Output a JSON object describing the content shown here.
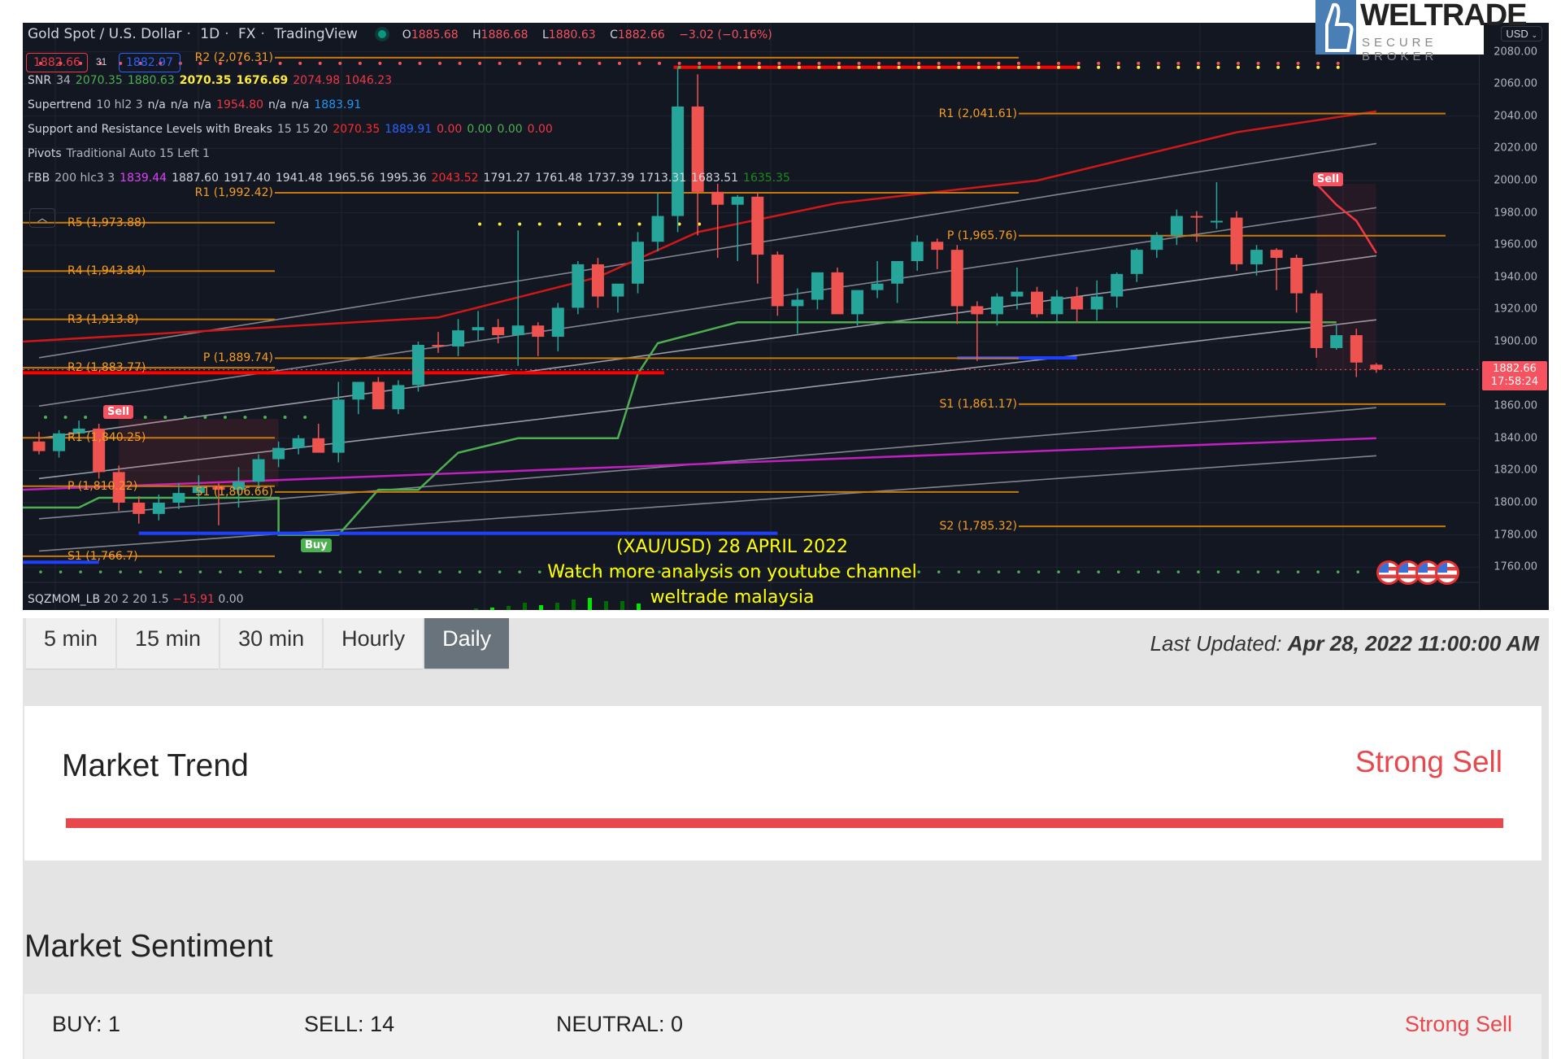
{
  "chart_header": {
    "symbol": "Gold Spot / U.S. Dollar",
    "interval": "1D",
    "exchange": "FX",
    "source": "TradingView",
    "open_label": "O",
    "open": "1885.68",
    "high_label": "H",
    "high": "1886.68",
    "low_label": "L",
    "low": "1880.63",
    "close_label": "C",
    "close": "1882.66",
    "change": "−3.02 (−0.16%)",
    "bid": "1882.66",
    "spread": "31",
    "ask": "1882.97"
  },
  "indicators": [
    {
      "name": "SNR",
      "params": "34",
      "values": [
        {
          "v": "2070.35",
          "c": "g"
        },
        {
          "v": "1880.63",
          "c": "g"
        },
        {
          "v": "2070.35",
          "c": "y"
        },
        {
          "v": "1676.69",
          "c": "y"
        },
        {
          "v": "2074.98",
          "c": "r"
        },
        {
          "v": "1046.23",
          "c": "r"
        }
      ]
    },
    {
      "name": "Supertrend",
      "params": "10 hl2 3",
      "values": [
        {
          "v": "n/a",
          "c": "w"
        },
        {
          "v": "n/a",
          "c": "w"
        },
        {
          "v": "n/a",
          "c": "w"
        },
        {
          "v": "1954.80",
          "c": "r"
        },
        {
          "v": "n/a",
          "c": "w"
        },
        {
          "v": "n/a",
          "c": "w"
        },
        {
          "v": "1883.91",
          "c": "sb"
        }
      ]
    },
    {
      "name": "Support and Resistance Levels with Breaks",
      "params": "15 15 20",
      "values": [
        {
          "v": "2070.35",
          "c": "rb"
        },
        {
          "v": "1889.91",
          "c": "b"
        },
        {
          "v": "0.00",
          "c": "r"
        },
        {
          "v": "0.00",
          "c": "g"
        },
        {
          "v": "0.00",
          "c": "g"
        },
        {
          "v": "0.00",
          "c": "r"
        }
      ]
    },
    {
      "name": "Pivots",
      "params": "Traditional Auto 15 Left 1",
      "values": []
    },
    {
      "name": "FBB",
      "params": "200 hlc3 3",
      "values": [
        {
          "v": "1839.44",
          "c": "m"
        },
        {
          "v": "1887.60",
          "c": "w"
        },
        {
          "v": "1917.40",
          "c": "w"
        },
        {
          "v": "1941.48",
          "c": "w"
        },
        {
          "v": "1965.56",
          "c": "w"
        },
        {
          "v": "1995.36",
          "c": "w"
        },
        {
          "v": "2043.52",
          "c": "rb"
        },
        {
          "v": "1791.27",
          "c": "w"
        },
        {
          "v": "1761.48",
          "c": "w"
        },
        {
          "v": "1737.39",
          "c": "w"
        },
        {
          "v": "1713.31",
          "c": "w"
        },
        {
          "v": "1683.51",
          "c": "w"
        },
        {
          "v": "1635.35",
          "c": "dg"
        }
      ]
    }
  ],
  "sqzmom": {
    "name": "SQZMOM_LB",
    "params": "20 2 20 1.5",
    "value1": "−15.91",
    "value2": "0.00"
  },
  "price_axis": {
    "currency": "USD",
    "ticks": [
      "2080.00",
      "2060.00",
      "2040.00",
      "2020.00",
      "2000.00",
      "1980.00",
      "1960.00",
      "1940.00",
      "1920.00",
      "1900.00",
      "1860.00",
      "1840.00",
      "1820.00",
      "1800.00",
      "1780.00",
      "1760.00"
    ],
    "current_price": "1882.66",
    "countdown": "17:58:24"
  },
  "logo": {
    "name": "WELTRADE",
    "tagline": "SECURE BROKER"
  },
  "annotation": {
    "line1": "(XAU/USD) 28 APRIL 2022",
    "line2": "Watch more analysis on youtube channel",
    "line3": "weltrade malaysia"
  },
  "signals": {
    "sell_label": "Sell",
    "buy_label": "Buy"
  },
  "chart_data": {
    "type": "candlestick",
    "title": "Gold Spot / U.S. Dollar · 1D · FX",
    "ylim": [
      1750,
      2090
    ],
    "ylabel": "USD",
    "pivot_levels": [
      {
        "label": "R5 (1,973.88)",
        "value": 1973.88,
        "period": 0
      },
      {
        "label": "R4 (1,943.84)",
        "value": 1943.84,
        "period": 0
      },
      {
        "label": "R3 (1,913.8)",
        "value": 1913.8,
        "period": 0
      },
      {
        "label": "R2 (1,883.77)",
        "value": 1883.77,
        "period": 0
      },
      {
        "label": "R1 (1,840.25)",
        "value": 1840.25,
        "period": 0
      },
      {
        "label": "P (1,810.22)",
        "value": 1810.22,
        "period": 0
      },
      {
        "label": "S1 (1,766.7)",
        "value": 1766.7,
        "period": 0
      },
      {
        "label": "R2 (2,076.31)",
        "value": 2076.31,
        "period": 1
      },
      {
        "label": "R1 (1,992.42)",
        "value": 1992.42,
        "period": 1
      },
      {
        "label": "P (1,889.74)",
        "value": 1889.74,
        "period": 1
      },
      {
        "label": "S1 (1,806.66)",
        "value": 1806.66,
        "period": 1
      },
      {
        "label": "R1 (2,041.61)",
        "value": 2041.61,
        "period": 2
      },
      {
        "label": "P (1,965.76)",
        "value": 1965.76,
        "period": 2
      },
      {
        "label": "S1 (1,861.17)",
        "value": 1861.17,
        "period": 2
      },
      {
        "label": "S2 (1,785.32)",
        "value": 1785.32,
        "period": 2
      }
    ],
    "candles": [
      [
        1838,
        1844,
        1830,
        1832
      ],
      [
        1832,
        1845,
        1828,
        1843
      ],
      [
        1843,
        1851,
        1838,
        1846
      ],
      [
        1846,
        1849,
        1815,
        1819
      ],
      [
        1819,
        1823,
        1795,
        1800
      ],
      [
        1800,
        1804,
        1787,
        1793
      ],
      [
        1793,
        1805,
        1789,
        1800
      ],
      [
        1800,
        1812,
        1796,
        1806
      ],
      [
        1806,
        1817,
        1798,
        1810
      ],
      [
        1810,
        1812,
        1786,
        1808
      ],
      [
        1808,
        1822,
        1797,
        1813
      ],
      [
        1813,
        1830,
        1808,
        1827
      ],
      [
        1827,
        1838,
        1822,
        1834
      ],
      [
        1834,
        1842,
        1830,
        1840
      ],
      [
        1840,
        1849,
        1834,
        1831
      ],
      [
        1831,
        1875,
        1825,
        1864
      ],
      [
        1864,
        1872,
        1855,
        1875
      ],
      [
        1875,
        1878,
        1858,
        1858
      ],
      [
        1858,
        1876,
        1855,
        1873
      ],
      [
        1873,
        1900,
        1869,
        1898
      ],
      [
        1898,
        1906,
        1893,
        1897
      ],
      [
        1897,
        1914,
        1891,
        1907
      ],
      [
        1907,
        1919,
        1901,
        1909
      ],
      [
        1909,
        1914,
        1899,
        1904
      ],
      [
        1904,
        1969,
        1885,
        1910
      ],
      [
        1910,
        1912,
        1891,
        1903
      ],
      [
        1903,
        1924,
        1894,
        1921
      ],
      [
        1921,
        1950,
        1917,
        1948
      ],
      [
        1948,
        1952,
        1921,
        1928
      ],
      [
        1928,
        1935,
        1918,
        1936
      ],
      [
        1936,
        1968,
        1930,
        1962
      ],
      [
        1962,
        1992,
        1956,
        1978
      ],
      [
        1978,
        2070,
        1968,
        2046
      ],
      [
        2046,
        2066,
        1966,
        1993
      ],
      [
        1993,
        1998,
        1952,
        1985
      ],
      [
        1985,
        1991,
        1950,
        1990
      ],
      [
        1990,
        1993,
        1936,
        1954
      ],
      [
        1954,
        1956,
        1916,
        1922
      ],
      [
        1922,
        1933,
        1905,
        1926
      ],
      [
        1926,
        1943,
        1920,
        1943
      ],
      [
        1943,
        1946,
        1918,
        1917
      ],
      [
        1917,
        1932,
        1910,
        1932
      ],
      [
        1932,
        1950,
        1927,
        1936
      ],
      [
        1936,
        1950,
        1924,
        1950
      ],
      [
        1950,
        1966,
        1944,
        1962
      ],
      [
        1962,
        1964,
        1945,
        1957
      ],
      [
        1957,
        1960,
        1911,
        1922
      ],
      [
        1922,
        1925,
        1888,
        1917
      ],
      [
        1917,
        1930,
        1910,
        1928
      ],
      [
        1928,
        1946,
        1920,
        1931
      ],
      [
        1931,
        1934,
        1915,
        1917
      ],
      [
        1917,
        1932,
        1912,
        1928
      ],
      [
        1928,
        1934,
        1912,
        1920
      ],
      [
        1920,
        1938,
        1913,
        1928
      ],
      [
        1928,
        1943,
        1921,
        1942
      ],
      [
        1942,
        1958,
        1937,
        1957
      ],
      [
        1957,
        1968,
        1952,
        1966
      ],
      [
        1966,
        1982,
        1960,
        1978
      ],
      [
        1978,
        1981,
        1962,
        1977
      ],
      [
        1975,
        1999,
        1970,
        1975
      ],
      [
        1977,
        1981,
        1944,
        1948
      ],
      [
        1948,
        1960,
        1941,
        1957
      ],
      [
        1957,
        1958,
        1932,
        1952
      ],
      [
        1952,
        1954,
        1918,
        1930
      ],
      [
        1930,
        1932,
        1890,
        1896
      ],
      [
        1896,
        1911,
        1895,
        1904
      ],
      [
        1904,
        1908,
        1878,
        1887
      ],
      [
        1885.68,
        1886.68,
        1880.63,
        1882.66
      ]
    ]
  },
  "widget": {
    "tabs": [
      {
        "label": "5 min",
        "active": false
      },
      {
        "label": "15 min",
        "active": false
      },
      {
        "label": "30 min",
        "active": false
      },
      {
        "label": "Hourly",
        "active": false
      },
      {
        "label": "Daily",
        "active": true
      }
    ],
    "last_updated_label": "Last Updated:",
    "last_updated_value": "Apr 28, 2022 11:00:00 AM",
    "market_trend": {
      "title": "Market Trend",
      "value": "Strong Sell",
      "strength_pct": 100,
      "color": "#e8484c"
    },
    "market_sentiment": {
      "title": "Market Sentiment",
      "buy": "BUY: 1",
      "sell": "SELL: 14",
      "neutral": "NEUTRAL: 0",
      "verdict": "Strong Sell"
    }
  }
}
